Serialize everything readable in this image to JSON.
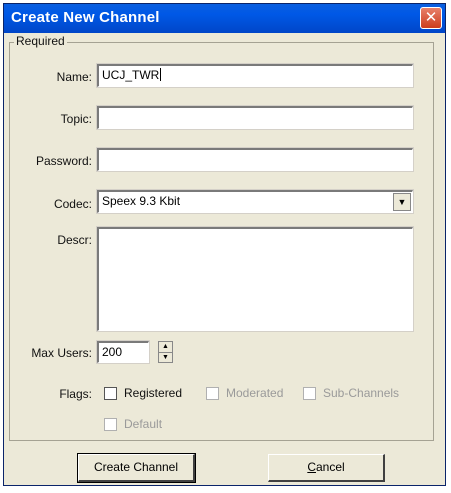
{
  "window": {
    "title": "Create New Channel",
    "close_glyph": "✕"
  },
  "group": {
    "legend": "Required"
  },
  "fields": {
    "name": {
      "label": "Name:",
      "value": "UCJ_TWR"
    },
    "topic": {
      "label": "Topic:",
      "value": ""
    },
    "password": {
      "label": "Password:",
      "value": ""
    },
    "codec": {
      "label": "Codec:",
      "value": "Speex 9.3 Kbit"
    },
    "descr": {
      "label": "Descr:",
      "value": ""
    },
    "max_users": {
      "label": "Max Users:",
      "value": "200"
    }
  },
  "flags": {
    "label": "Flags:",
    "registered": "Registered",
    "moderated": "Moderated",
    "sub_channels": "Sub-Channels",
    "default": "Default"
  },
  "buttons": {
    "create": "Create Channel",
    "cancel": "Cancel"
  },
  "icons": {
    "close": "close-icon",
    "dropdown": "chevron-down-icon",
    "spin_up": "spin-up-icon",
    "spin_down": "spin-down-icon"
  }
}
